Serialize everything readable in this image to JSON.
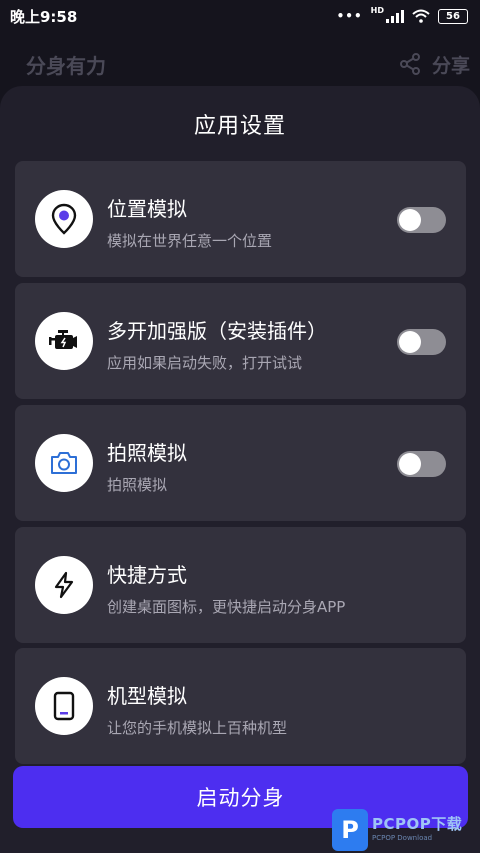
{
  "status_bar": {
    "time": "晚上9:58",
    "network": "HD",
    "battery": "56"
  },
  "background_header": {
    "title": "分身有力",
    "share_label": "分享"
  },
  "sheet": {
    "title": "应用设置",
    "cards": [
      {
        "title": "位置模拟",
        "subtitle": "模拟在世界任意一个位置",
        "icon": "location-pin-icon",
        "toggle": false
      },
      {
        "title": "多开加强版（安装插件）",
        "subtitle": "应用如果启动失败，打开试试",
        "icon": "engine-icon",
        "toggle": false
      },
      {
        "title": "拍照模拟",
        "subtitle": "拍照模拟",
        "icon": "camera-icon",
        "toggle": false
      },
      {
        "title": "快捷方式",
        "subtitle": "创建桌面图标，更快捷启动分身APP",
        "icon": "lightning-icon"
      },
      {
        "title": "机型模拟",
        "subtitle": "让您的手机模拟上百种机型",
        "icon": "phone-icon"
      }
    ],
    "launch_button": "启动分身"
  },
  "watermark": {
    "logo_letter": "P",
    "main": "PCPOP下载",
    "sub": "PCPOP Download"
  },
  "colors": {
    "accent": "#4d2ef0",
    "icon_purple": "#5b3de8",
    "card_bg": "#33313d",
    "sheet_bg": "#211f2b"
  }
}
